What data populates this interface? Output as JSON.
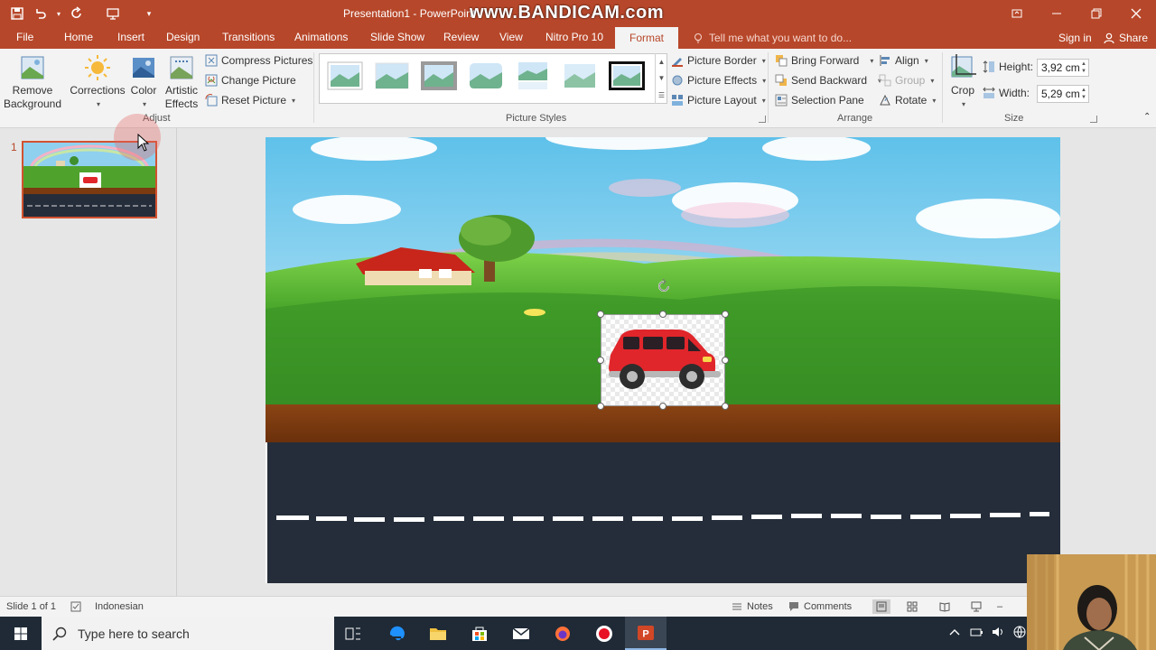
{
  "titlebar": {
    "title": "Presentation1 - PowerPoint",
    "watermark": "www.BANDICAM.com"
  },
  "tabs": [
    {
      "label": "File"
    },
    {
      "label": "Home"
    },
    {
      "label": "Insert"
    },
    {
      "label": "Design"
    },
    {
      "label": "Transitions"
    },
    {
      "label": "Animations"
    },
    {
      "label": "Slide Show"
    },
    {
      "label": "Review"
    },
    {
      "label": "View"
    },
    {
      "label": "Nitro Pro 10"
    },
    {
      "label": "Format"
    }
  ],
  "tell_me": "Tell me what you want to do...",
  "signin": "Sign in",
  "share": "Share",
  "ribbon": {
    "remove_bg": [
      "Remove",
      "Background"
    ],
    "corrections": "Corrections",
    "color": "Color",
    "artistic": [
      "Artistic",
      "Effects"
    ],
    "compress": "Compress Pictures",
    "change": "Change Picture",
    "reset": "Reset Picture",
    "adjust_label": "Adjust",
    "picture_border": "Picture Border",
    "picture_effects": "Picture Effects",
    "picture_layout": "Picture Layout",
    "styles_label": "Picture Styles",
    "bring_forward": "Bring Forward",
    "send_backward": "Send Backward",
    "selection_pane": "Selection Pane",
    "align": "Align",
    "group": "Group",
    "rotate": "Rotate",
    "arrange_label": "Arrange",
    "crop": "Crop",
    "height_label": "Height:",
    "height_value": "3,92 cm",
    "width_label": "Width:",
    "width_value": "5,29 cm",
    "size_label": "Size"
  },
  "slide_panel": {
    "number": "1"
  },
  "status": {
    "slide": "Slide 1 of 1",
    "language": "Indonesian",
    "notes": "Notes",
    "comments": "Comments"
  },
  "taskbar": {
    "search_placeholder": "Type here to search"
  },
  "colors": {
    "accent": "#b7472a",
    "road": "#252d3a",
    "car": "#e0262b"
  }
}
